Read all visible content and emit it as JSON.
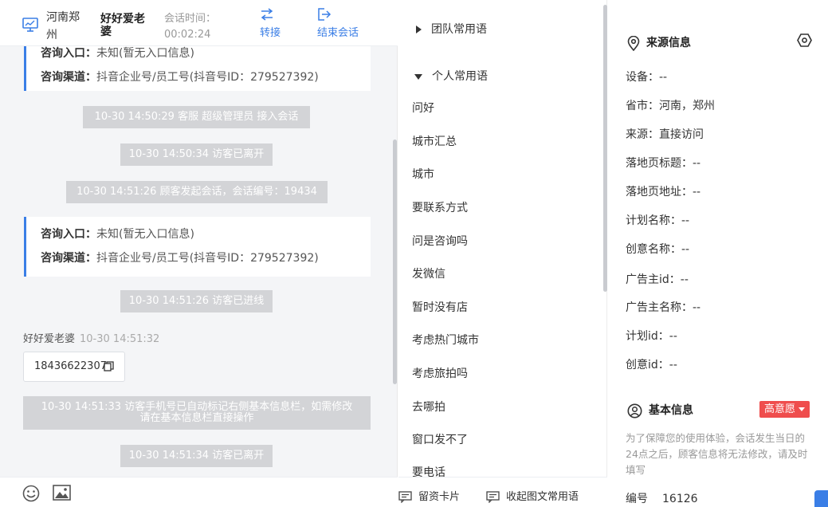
{
  "header": {
    "location": "河南郑州",
    "visitor_name": "好好爱老婆",
    "session_time_label": "会话时间：",
    "session_time": "00:02:24",
    "transfer_label": "转接",
    "end_session_label": "结束会话"
  },
  "chat": {
    "card1": {
      "entry_label": "咨询入口：",
      "entry_value": "未知(暂无入口信息)",
      "channel_label": "咨询渠道：",
      "channel_value": "抖音企业号/员工号(抖音号ID：279527392)"
    },
    "sys1": "10-30 14:50:29 客服 超级管理员 接入会话",
    "sys2": "10-30 14:50:34 访客已离开",
    "sys3": "10-30 14:51:26 顾客发起会话，会话编号：19434",
    "card2": {
      "entry_label": "咨询入口：",
      "entry_value": "未知(暂无入口信息)",
      "channel_label": "咨询渠道：",
      "channel_value": "抖音企业号/员工号(抖音号ID：279527392)"
    },
    "sys4": "10-30 14:51:26 访客已进线",
    "sender_name": "好好爱老婆",
    "sender_time": "10-30 14:51:32",
    "phone": "18436622307",
    "sys5_line1": "10-30 14:51:33 访客手机号已自动标记右侧基本信息栏，如需修改",
    "sys5_line2": "请在基本信息栏直接操作",
    "sys6": "10-30 14:51:34 访客已离开"
  },
  "phrases": {
    "team_group": "团队常用语",
    "personal_group": "个人常用语",
    "items": [
      "问好",
      "城市汇总",
      "城市",
      "要联系方式",
      "问是咨询吗",
      "发微信",
      "暂时没有店",
      "考虑热门城市",
      "考虑旅拍吗",
      "去哪拍",
      "窗口发不了",
      "要电话"
    ],
    "footer_card": "留资卡片",
    "footer_collapse": "收起图文常用语"
  },
  "info": {
    "source_title": "来源信息",
    "fields": [
      {
        "label": "设备：",
        "value": "--"
      },
      {
        "label": "省市：",
        "value": "河南，郑州"
      },
      {
        "label": "来源：",
        "value": "直接访问"
      },
      {
        "label": "落地页标题：",
        "value": "--"
      },
      {
        "label": "落地页地址：",
        "value": "--"
      },
      {
        "label": "计划名称：",
        "value": "--"
      },
      {
        "label": "创意名称：",
        "value": "--"
      },
      {
        "label": "广告主id：",
        "value": "--"
      },
      {
        "label": "广告主名称：",
        "value": "--"
      },
      {
        "label": "计划id：",
        "value": "--"
      },
      {
        "label": "创意id：",
        "value": "--"
      }
    ],
    "basic_title": "基本信息",
    "intent_label": "高意愿",
    "notice": "为了保障您的使用体验，会话发生当日的24点之后，顾客信息将无法修改，请及时填写",
    "id_label": "编号",
    "id_value": "16126"
  },
  "colors": {
    "accent": "#3a7ee6",
    "intent": "#ef4d4d",
    "system_bubble": "#d3d4d7"
  }
}
